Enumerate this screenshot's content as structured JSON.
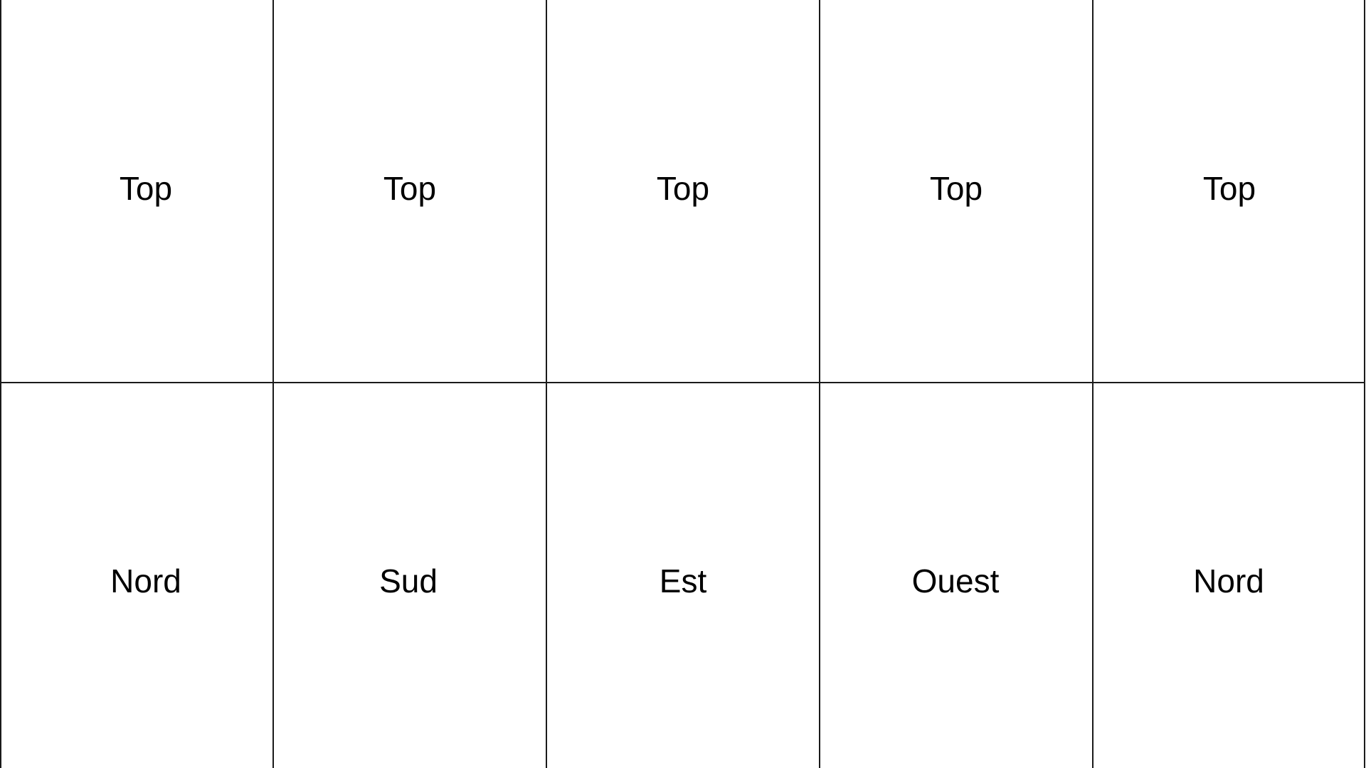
{
  "grid": {
    "top_row": [
      "Top",
      "Top",
      "Top",
      "Top",
      "Top"
    ],
    "bottom_row": [
      "Nord",
      "Sud",
      "Est",
      "Ouest",
      "Nord"
    ],
    "line_color": "#1a1a1a",
    "background_color": "#ffffff"
  }
}
